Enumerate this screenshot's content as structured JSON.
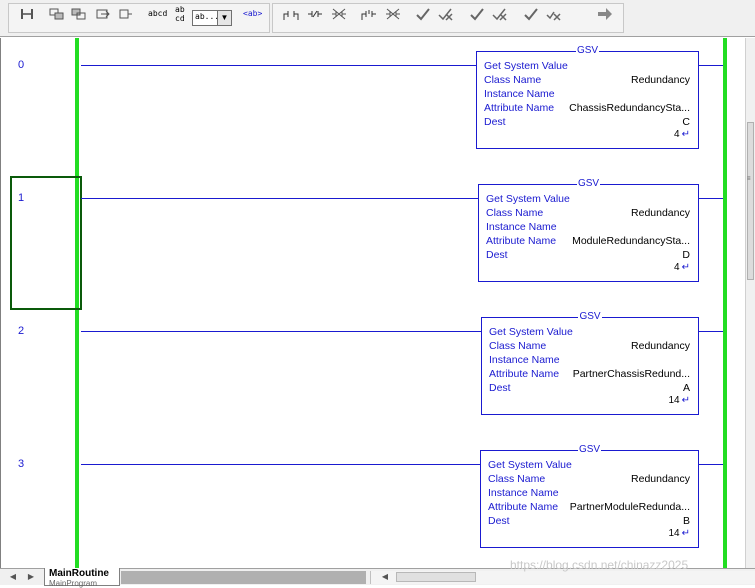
{
  "toolbar": {
    "text_items": [
      "abcd",
      "ab",
      "cd",
      "ab...",
      "<ab>"
    ],
    "edit_value": "ab..."
  },
  "rungs": [
    {
      "number": "0",
      "block": {
        "title": "GSV",
        "name": "Get System Value",
        "class_label": "Class Name",
        "class_value": "Redundancy",
        "instance_label": "Instance Name",
        "instance_value": "",
        "attribute_label": "Attribute Name",
        "attribute_value": "ChassisRedundancySta...",
        "dest_label": "Dest",
        "dest_value": "C",
        "dest_current": "4"
      }
    },
    {
      "number": "1",
      "block": {
        "title": "GSV",
        "name": "Get System Value",
        "class_label": "Class Name",
        "class_value": "Redundancy",
        "instance_label": "Instance Name",
        "instance_value": "",
        "attribute_label": "Attribute Name",
        "attribute_value": "ModuleRedundancySta...",
        "dest_label": "Dest",
        "dest_value": "D",
        "dest_current": "4"
      }
    },
    {
      "number": "2",
      "block": {
        "title": "GSV",
        "name": "Get System Value",
        "class_label": "Class Name",
        "class_value": "Redundancy",
        "instance_label": "Instance Name",
        "instance_value": "",
        "attribute_label": "Attribute Name",
        "attribute_value": "PartnerChassisRedund...",
        "dest_label": "Dest",
        "dest_value": "A",
        "dest_current": "14"
      }
    },
    {
      "number": "3",
      "block": {
        "title": "GSV",
        "name": "Get System Value",
        "class_label": "Class Name",
        "class_value": "Redundancy",
        "instance_label": "Instance Name",
        "instance_value": "",
        "attribute_label": "Attribute Name",
        "attribute_value": "PartnerModuleRedunda...",
        "dest_label": "Dest",
        "dest_value": "B",
        "dest_current": "14"
      }
    }
  ],
  "tab": {
    "routine": "MainRoutine",
    "program": "MainProgram"
  },
  "watermark": "https://blog.csdn.net/chinazz2025",
  "colors": {
    "rail": "#22dd22",
    "wire": "#1a1ad0",
    "selection": "#0a5a0a"
  }
}
